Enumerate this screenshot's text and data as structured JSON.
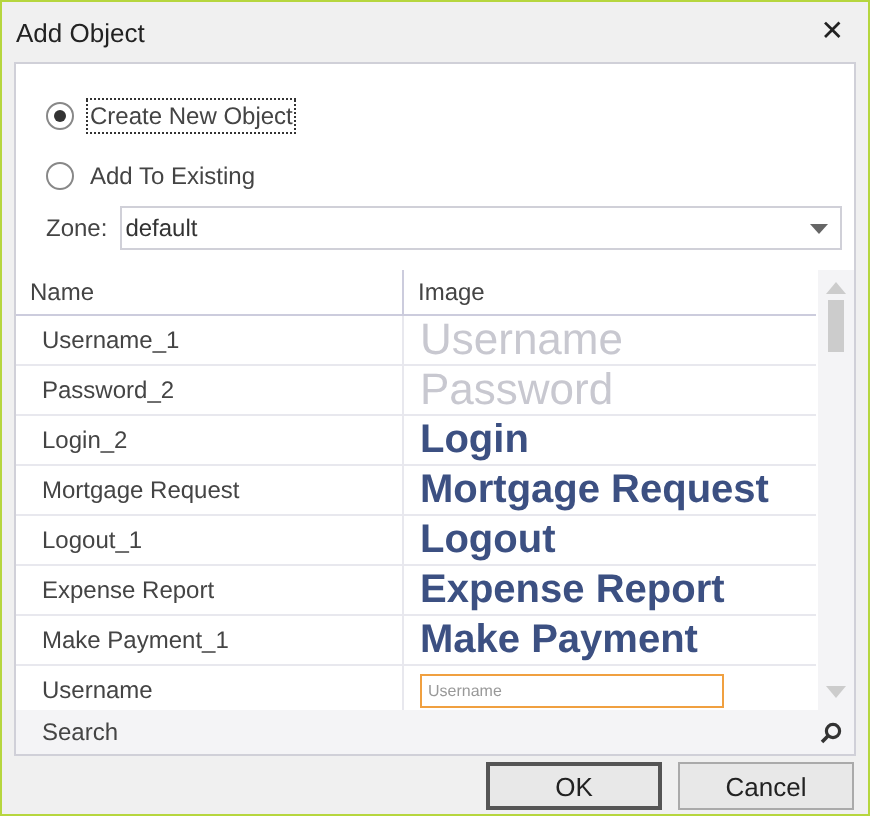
{
  "window": {
    "title": "Add Object",
    "close": "✕"
  },
  "options": [
    {
      "label": "Create New Object",
      "selected": true,
      "focused": true
    },
    {
      "label": "Add To Existing",
      "selected": false,
      "focused": false
    }
  ],
  "zone": {
    "label": "Zone:",
    "value": "default"
  },
  "table": {
    "columns": [
      "Name",
      "Image"
    ],
    "rows": [
      {
        "name": "Username_1",
        "image": "Username",
        "kind": "faded"
      },
      {
        "name": "Password_2",
        "image": "Password",
        "kind": "faded"
      },
      {
        "name": "Login_2",
        "image": "Login",
        "kind": "bold"
      },
      {
        "name": "Mortgage Request",
        "image": "Mortgage Request",
        "kind": "bold"
      },
      {
        "name": "Logout_1",
        "image": "Logout",
        "kind": "bold"
      },
      {
        "name": "Expense Report",
        "image": "Expense Report",
        "kind": "bold"
      },
      {
        "name": "Make Payment_1",
        "image": "Make Payment",
        "kind": "bold"
      },
      {
        "name": "Username",
        "image": "Username",
        "kind": "field"
      }
    ]
  },
  "search": {
    "placeholder": "Search"
  },
  "buttons": [
    "OK",
    "Cancel"
  ]
}
